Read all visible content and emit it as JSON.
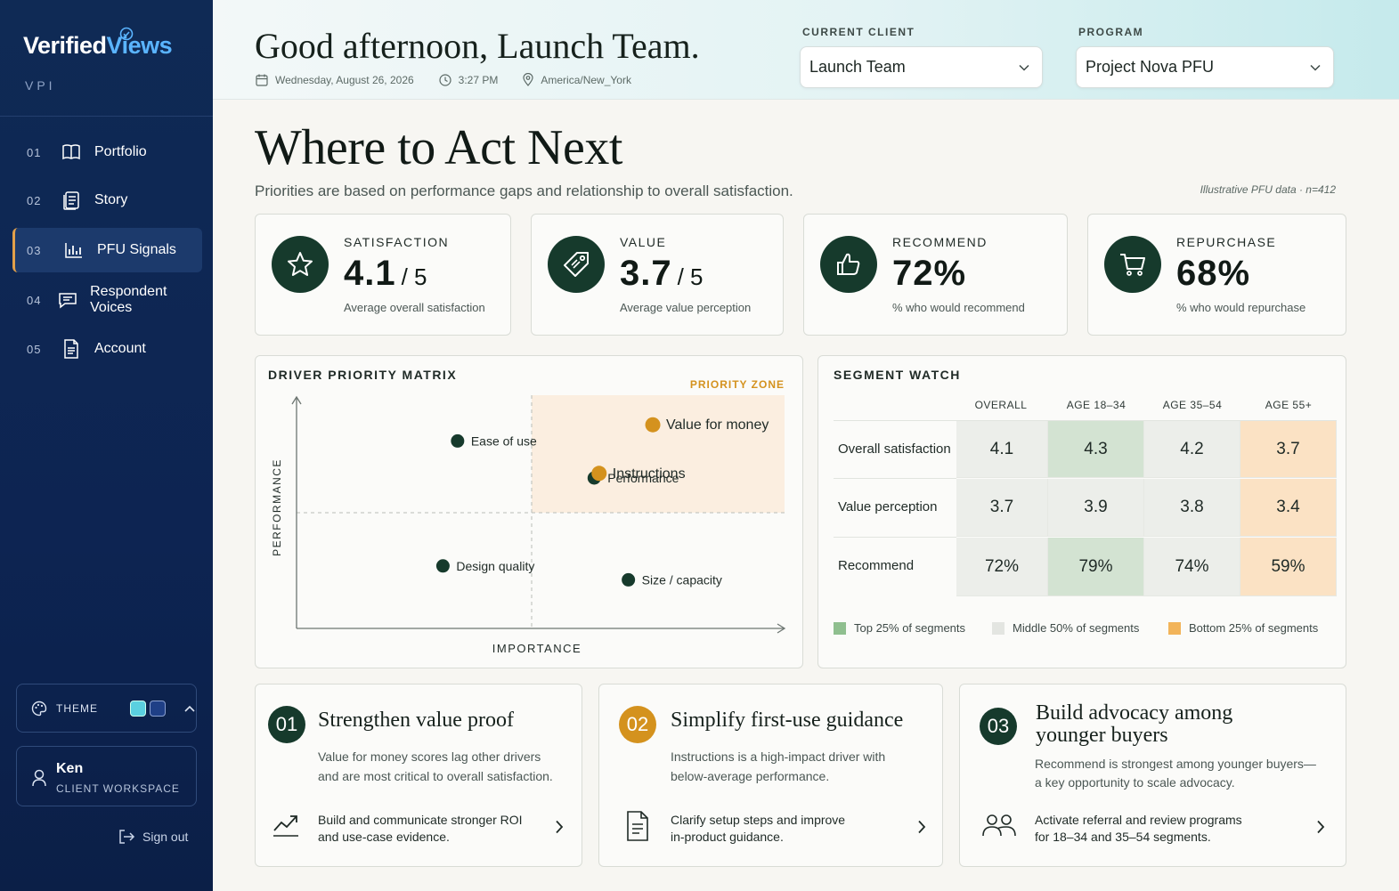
{
  "brand": {
    "name_part1": "Verified",
    "name_part2": "Views",
    "subtitle": "VPI"
  },
  "nav": [
    {
      "num": "01",
      "label": "Portfolio",
      "icon": "book-icon"
    },
    {
      "num": "02",
      "label": "Story",
      "icon": "document-list-icon"
    },
    {
      "num": "03",
      "label": "PFU Signals",
      "icon": "bar-chart-icon",
      "active": true
    },
    {
      "num": "04",
      "label": "Respondent Voices",
      "icon": "chat-icon"
    },
    {
      "num": "05",
      "label": "Account",
      "icon": "file-icon"
    }
  ],
  "theme": {
    "label": "THEME",
    "swatch_colors": [
      "#5ad0e0",
      "#1f3f86"
    ]
  },
  "user": {
    "name": "Ken",
    "role": "CLIENT WORKSPACE",
    "signout": "Sign out"
  },
  "header": {
    "greeting": "Good afternoon, Launch Team.",
    "date": "Wednesday, August 26, 2026",
    "time": "3:27 PM",
    "timezone": "America/New_York",
    "client_label": "CURRENT CLIENT",
    "client_value": "Launch Team",
    "program_label": "PROGRAM",
    "program_value": "Project Nova PFU"
  },
  "page": {
    "title": "Where to Act Next",
    "subtitle": "Priorities are based on performance gaps and relationship to overall satisfaction.",
    "data_note": "Illustrative PFU data · n=412"
  },
  "kpis": [
    {
      "label": "SATISFACTION",
      "value": "4.1",
      "unit": "/ 5",
      "desc": "Average overall satisfaction",
      "icon": "star-icon"
    },
    {
      "label": "VALUE",
      "value": "3.7",
      "unit": "/ 5",
      "desc": "Average value perception",
      "icon": "price-tag-icon"
    },
    {
      "label": "RECOMMEND",
      "value": "72%",
      "unit": "",
      "desc": "% who would recommend",
      "icon": "thumbs-up-icon"
    },
    {
      "label": "REPURCHASE",
      "value": "68%",
      "unit": "",
      "desc": "% who would repurchase",
      "icon": "shopping-cart-icon"
    }
  ],
  "matrix": {
    "title": "DRIVER PRIORITY MATRIX",
    "zone_label": "PRIORITY ZONE",
    "xlabel": "IMPORTANCE",
    "ylabel": "PERFORMANCE",
    "dot_colors": {
      "dark": "#163a2c",
      "priority": "#d4921e"
    },
    "points": [
      {
        "label": "Ease of use",
        "importance": 0.33,
        "performance": 0.81,
        "priority": false
      },
      {
        "label": "Performance",
        "importance": 0.61,
        "performance": 0.65,
        "priority": false
      },
      {
        "label": "Value for money",
        "importance": 0.73,
        "performance": 0.88,
        "priority": true
      },
      {
        "label": "Instructions",
        "importance": 0.62,
        "performance": 0.67,
        "priority": true
      },
      {
        "label": "Design quality",
        "importance": 0.3,
        "performance": 0.27,
        "priority": false
      },
      {
        "label": "Size / capacity",
        "importance": 0.68,
        "performance": 0.21,
        "priority": false
      }
    ]
  },
  "segments": {
    "title": "SEGMENT WATCH",
    "columns": [
      "OVERALL",
      "AGE 18–34",
      "AGE 35–54",
      "AGE 55+"
    ],
    "rows": [
      {
        "label": "Overall satisfaction",
        "values": [
          "4.1",
          "4.3",
          "4.2",
          "3.7"
        ],
        "tiers": [
          "mid",
          "top",
          "mid",
          "bottom"
        ]
      },
      {
        "label": "Value perception",
        "values": [
          "3.7",
          "3.9",
          "3.8",
          "3.4"
        ],
        "tiers": [
          "mid",
          "mid",
          "mid",
          "bottom"
        ]
      },
      {
        "label": "Recommend",
        "values": [
          "72%",
          "79%",
          "74%",
          "59%"
        ],
        "tiers": [
          "mid",
          "top",
          "mid",
          "bottom"
        ]
      }
    ],
    "tier_colors": {
      "top": "#d3e3d2",
      "mid": "#eceeea",
      "bottom": "#fbe2c4"
    },
    "legend": [
      {
        "label": "Top 25% of segments",
        "color": "#8fbf8f"
      },
      {
        "label": "Middle 50% of segments",
        "color": "#e3e5e1"
      },
      {
        "label": "Bottom 25% of segments",
        "color": "#f2b45a"
      }
    ]
  },
  "actions": [
    {
      "num": "01",
      "badge_color": "#163a2c",
      "title": "Strengthen value proof",
      "body": [
        "Value for money scores lag other drivers",
        "and are most critical to overall satisfaction."
      ],
      "step": [
        "Build and communicate stronger ROI",
        "and use-case evidence."
      ],
      "icon": "trend-up-icon"
    },
    {
      "num": "02",
      "badge_color": "#d4921e",
      "title": "Simplify first-use guidance",
      "body": [
        "Instructions is a high-impact driver with",
        "below-average performance."
      ],
      "step": [
        "Clarify setup steps and improve",
        "in-product guidance."
      ],
      "icon": "document-icon"
    },
    {
      "num": "03",
      "badge_color": "#163a2c",
      "title": "Build advocacy among younger buyers",
      "title_lines": [
        "Build advocacy among",
        "younger buyers"
      ],
      "body": [
        "Recommend is strongest among younger buyers—",
        "a key opportunity to scale advocacy."
      ],
      "step": [
        "Activate referral and review programs",
        "for 18–34 and 35–54 segments."
      ],
      "icon": "people-icon"
    }
  ]
}
